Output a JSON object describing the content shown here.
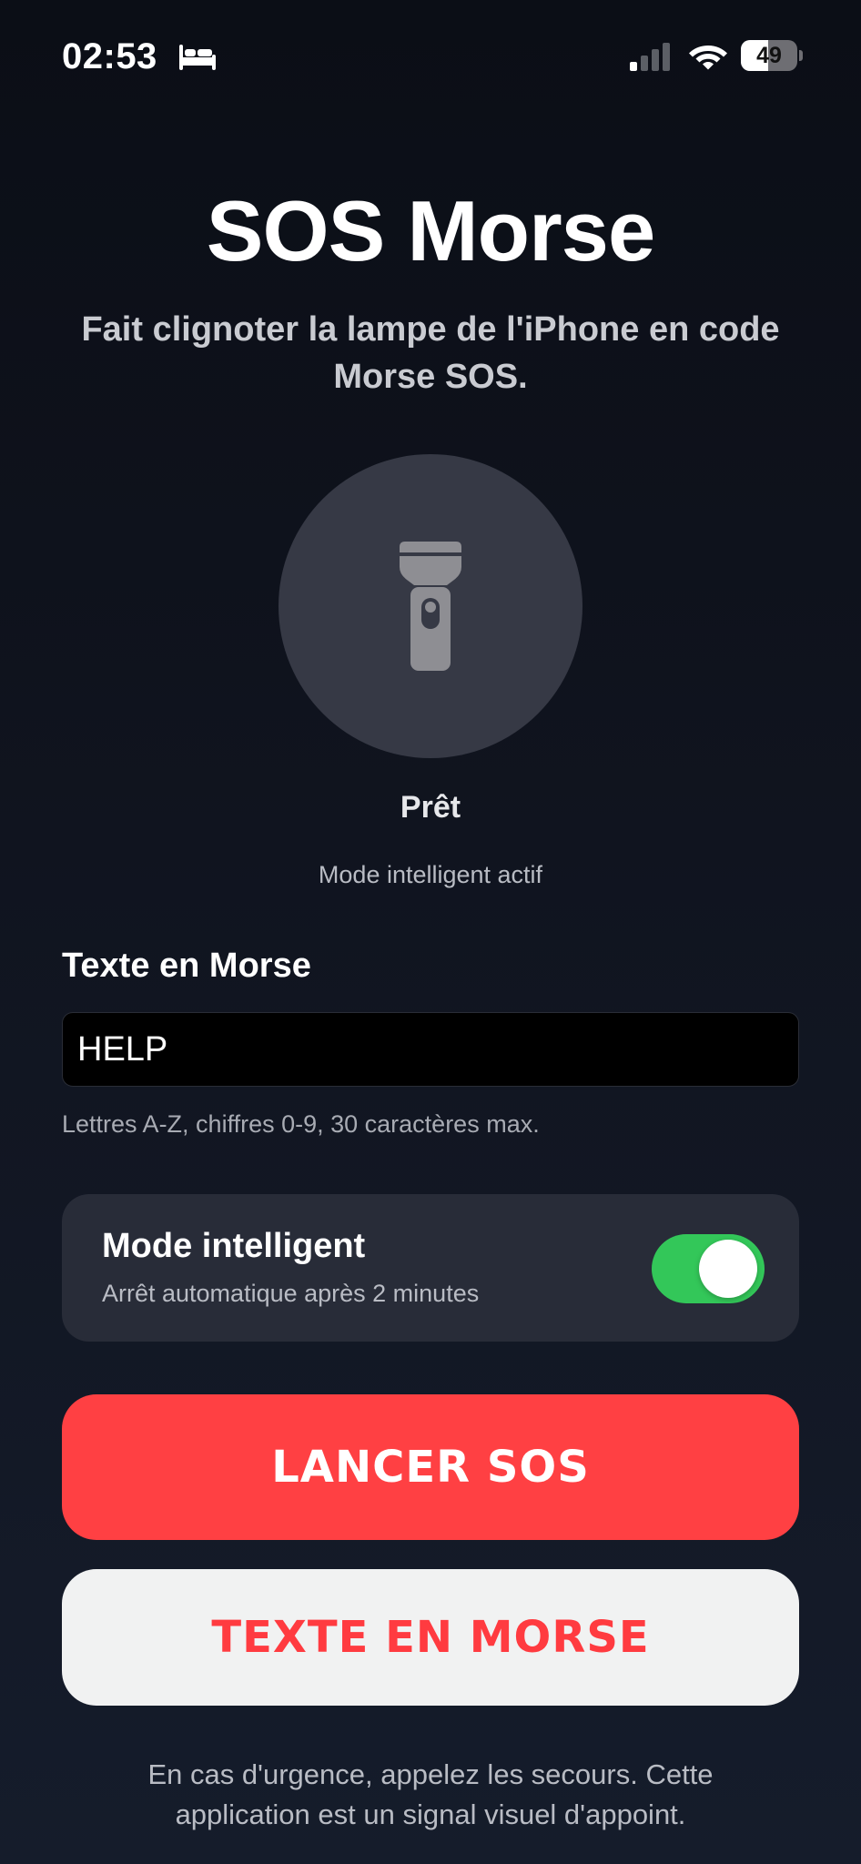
{
  "status_bar": {
    "time": "02:53",
    "sleep_icon": "bed-icon",
    "signal_icon": "cellular-signal-icon",
    "wifi_icon": "wifi-icon",
    "battery_level": "49",
    "battery_fraction": 0.49
  },
  "header": {
    "title": "SOS Morse",
    "subtitle": "Fait clignoter la lampe de l'iPhone en code Morse SOS."
  },
  "lamp": {
    "icon": "flashlight-icon",
    "status": "Prêt",
    "mode_status": "Mode intelligent actif"
  },
  "morse_text": {
    "label": "Texte en Morse",
    "value": "HELP",
    "hint": "Lettres A-Z, chiffres 0-9, 30 caractères max."
  },
  "smart_mode": {
    "title": "Mode intelligent",
    "subtitle": "Arrêt automatique après 2 minutes",
    "enabled": true,
    "accent_color": "#33c759"
  },
  "actions": {
    "sos_label": "LANCER SOS",
    "morse_label": "TEXTE EN MORSE",
    "sos_color": "#ff4043",
    "morse_text_color": "#ff3b40"
  },
  "footer": {
    "note": "En cas d'urgence, appelez les secours. Cette application est un signal visuel d'appoint."
  }
}
